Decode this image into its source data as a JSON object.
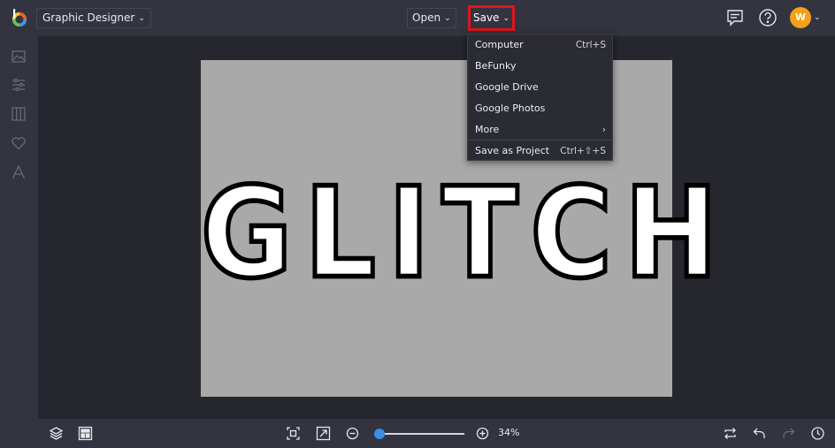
{
  "header": {
    "app_name": "Graphic Designer",
    "open_label": "Open",
    "save_label": "Save",
    "avatar_initial": "W",
    "avatar_color": "#f4a119"
  },
  "icons": {
    "logo": "befunky-logo-icon",
    "feedback": "chat-feedback-icon",
    "help": "help-question-icon",
    "sidebar": [
      "image-icon",
      "sliders-icon",
      "layout-columns-icon",
      "heart-icon",
      "text-icon"
    ]
  },
  "canvas": {
    "text": "GLITCH",
    "background": "#a9a9a9"
  },
  "save_menu": {
    "items": [
      {
        "label": "Computer",
        "shortcut": "Ctrl+S"
      },
      {
        "label": "BeFunky",
        "shortcut": ""
      },
      {
        "label": "Google Drive",
        "shortcut": ""
      },
      {
        "label": "Google Photos",
        "shortcut": ""
      },
      {
        "label": "More",
        "shortcut": "›"
      },
      {
        "label": "Save as Project",
        "shortcut": "Ctrl+⇧+S"
      }
    ]
  },
  "footer": {
    "zoom_label": "34%",
    "zoom_fraction": 0.06
  },
  "colors": {
    "highlight": "#e0141c",
    "accent": "#3b8de6"
  }
}
